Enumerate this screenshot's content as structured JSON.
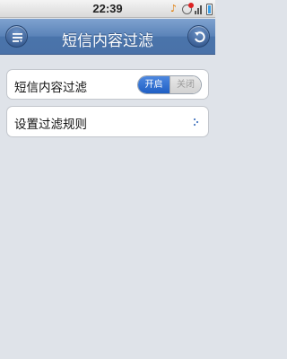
{
  "status_bar": {
    "time": "22:39",
    "icons": [
      "music-icon",
      "alarm-icon",
      "signal-icon",
      "battery-icon"
    ]
  },
  "title_bar": {
    "title": "短信内容过滤",
    "menu_icon": "menu-icon",
    "back_icon": "back-icon"
  },
  "settings": {
    "filter": {
      "label": "短信内容过滤",
      "toggle_on_label": "开启",
      "toggle_off_label": "关闭",
      "state": "on"
    },
    "rules": {
      "label": "设置过滤规则",
      "icon": "chevron-right-icon"
    }
  },
  "colors": {
    "title_bar": "#5a83b8",
    "toggle_active": "#2a6ad0",
    "background": "#dfe3e9"
  }
}
